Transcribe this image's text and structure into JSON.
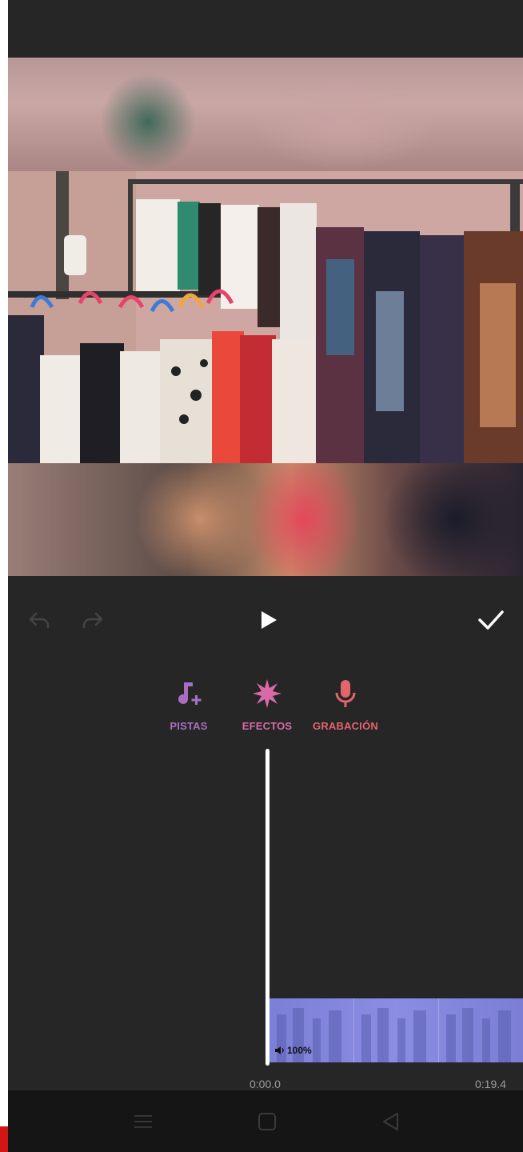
{
  "tools": {
    "tracks": {
      "label": "PISTAS",
      "icon": "music-note-add-icon",
      "color": "#a96ec1"
    },
    "effects": {
      "label": "EFECTOS",
      "icon": "starburst-icon",
      "color": "#d86aa9"
    },
    "record": {
      "label": "GRABACIÓN",
      "icon": "microphone-icon",
      "color": "#e2646d"
    }
  },
  "controls": {
    "undo": "undo-icon",
    "redo": "redo-icon",
    "play": "play-icon",
    "confirm": "checkmark-icon"
  },
  "timeline": {
    "clip_volume": "100%",
    "time_start": "0:00.0",
    "time_end": "0:19.4"
  },
  "nav": {
    "menu": "menu-icon",
    "home": "home-square-icon",
    "back": "back-triangle-icon"
  },
  "colors": {
    "background": "#262626",
    "clip": "#8285dc",
    "navbar": "#151515"
  }
}
